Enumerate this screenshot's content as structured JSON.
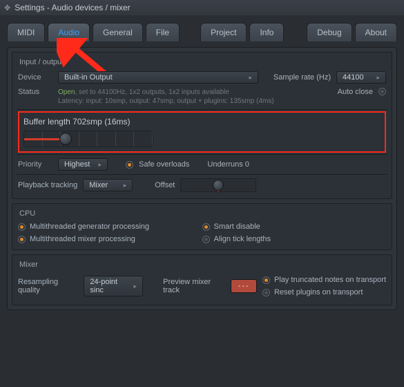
{
  "window": {
    "title": "Settings - Audio devices / mixer"
  },
  "tabs": [
    "MIDI",
    "Audio",
    "General",
    "File",
    "Project",
    "Info",
    "Debug",
    "About"
  ],
  "active_tab": 1,
  "io": {
    "title": "Input / output",
    "device_label": "Device",
    "device_value": "Built-in Output",
    "sample_rate_label": "Sample rate (Hz)",
    "sample_rate_value": "44100",
    "status_label": "Status",
    "status_open": "Open",
    "status_line1": ", set to 44100Hz, 1x2 outputs, 1x2 inputs available",
    "status_line2": "Latency: input: 10smp, output: 47smp, output + plugins: 135smp (4ms)",
    "auto_close": "Auto close",
    "buffer_title": "Buffer length 702smp (16ms)",
    "buffer_pos_pct": 32,
    "priority_label": "Priority",
    "priority_value": "Highest",
    "safe_overloads": "Safe overloads",
    "underruns": "Underruns 0",
    "playback_tracking_label": "Playback tracking",
    "playback_tracking_value": "Mixer",
    "offset_label": "Offset"
  },
  "cpu": {
    "title": "CPU",
    "opt1": "Multithreaded generator processing",
    "opt2": "Multithreaded mixer processing",
    "opt3": "Smart disable",
    "opt4": "Align tick lengths"
  },
  "mixer": {
    "title": "Mixer",
    "resampling_label": "Resampling quality",
    "resampling_value": "24-point sinc",
    "preview_label": "Preview mixer track",
    "opt1": "Play truncated notes on transport",
    "opt2": "Reset plugins on transport"
  }
}
